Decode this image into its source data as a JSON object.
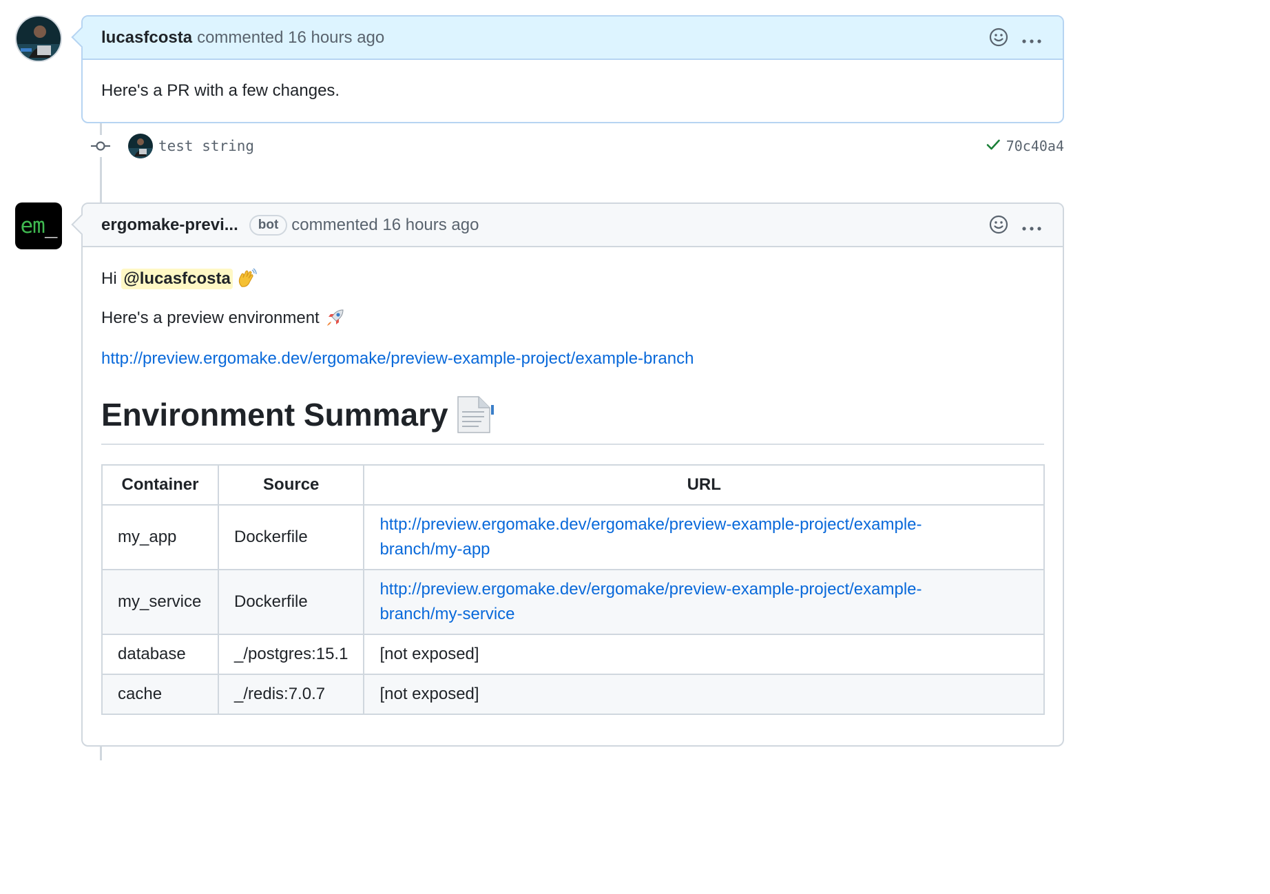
{
  "colors": {
    "accent_link": "#0969da",
    "author_header_bg": "#ddf4ff",
    "header_bg": "#f6f8fa",
    "success": "#1a7f37",
    "mention_bg": "#fff8c5",
    "bot_avatar_green": "#3fb950"
  },
  "comment1": {
    "author": "lucasfcosta",
    "verb_time": "commented 16 hours ago",
    "body": "Here's a PR with a few changes.",
    "icons": [
      "smiley-icon",
      "kebab-horizontal-icon"
    ]
  },
  "commit": {
    "message": "test string",
    "status_icon": "check-icon",
    "sha": "70c40a4"
  },
  "comment2": {
    "avatar_text_green": "em",
    "avatar_text_white": "_",
    "author": "ergomake-previ...",
    "badge": "bot",
    "verb_time": "commented 16 hours ago",
    "greeting": "Hi",
    "mention": "@lucasfcosta",
    "wave_icon": "waving-hand-icon",
    "preview_text": "Here's a preview environment",
    "rocket_icon": "rocket-icon",
    "preview_url": "http://preview.ergomake.dev/ergomake/preview-example-project/example-branch",
    "summary_heading": "Environment Summary",
    "summary_icon": "document-icon",
    "table": {
      "headers": [
        "Container",
        "Source",
        "URL"
      ],
      "rows": [
        {
          "container": "my_app",
          "source": "Dockerfile",
          "url_line1": "http://preview.ergomake.dev/ergomake/preview-example-project/example-",
          "url_line2": "branch/my-app"
        },
        {
          "container": "my_service",
          "source": "Dockerfile",
          "url_line1": "http://preview.ergomake.dev/ergomake/preview-example-project/example-",
          "url_line2": "branch/my-service"
        },
        {
          "container": "database",
          "source": "_/postgres:15.1",
          "url": "[not exposed]"
        },
        {
          "container": "cache",
          "source": "_/redis:7.0.7",
          "url": "[not exposed]"
        }
      ]
    }
  }
}
